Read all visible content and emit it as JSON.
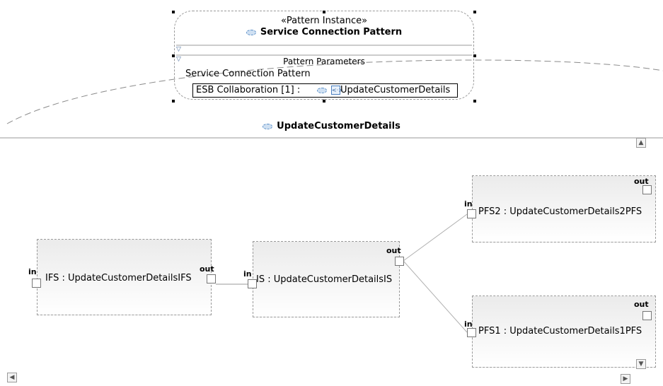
{
  "pattern_instance": {
    "stereotype": "«Pattern Instance»",
    "name": "Service Connection Pattern",
    "parameters_heading": "Pattern Parameters",
    "pattern_label": "Service Connection Pattern",
    "parameter": {
      "label": "ESB Collaboration [1] :",
      "value": "UpdateCustomerDetails"
    }
  },
  "collaboration": {
    "name": "UpdateCustomerDetails"
  },
  "parts": [
    {
      "label": "IFS : UpdateCustomerDetailsIFS",
      "in_port": "in",
      "out_port": "out"
    },
    {
      "label": "IS : UpdateCustomerDetailsIS",
      "in_port": "in",
      "out_port": "out"
    },
    {
      "label": "PFS2 : UpdateCustomerDetails2PFS",
      "in_port": "in",
      "out_port": "out"
    },
    {
      "label": "PFS1 : UpdateCustomerDetails1PFS",
      "in_port": "in",
      "out_port": "out"
    }
  ],
  "connectors": [
    {
      "from": "IFS.out",
      "to": "IS.in"
    },
    {
      "from": "IS.out",
      "to": "PFS2.in"
    },
    {
      "from": "IS.out",
      "to": "PFS1.in"
    }
  ],
  "icons": {
    "collaboration": "collaboration-icon",
    "interface": "interface-icon",
    "scroll_up": "scroll-up-icon",
    "scroll_down": "scroll-down-icon",
    "scroll_left": "scroll-left-icon",
    "scroll_right": "scroll-right-icon"
  }
}
